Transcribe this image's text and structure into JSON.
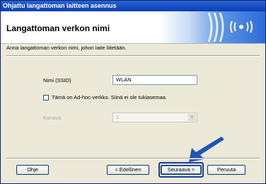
{
  "window": {
    "title": "Ohjattu langattoman laitteen asennus"
  },
  "header": {
    "title": "Langattoman verkon nimi"
  },
  "main": {
    "intro": "Anna langattoman verkon nimi, johon laite liitetään.",
    "ssid": {
      "label": "Nimi (SSID)",
      "value": "WLAN"
    },
    "adhoc": {
      "label": "Tämä on Ad-hoc-verkko. Siinä ei ole tukiasemaa.",
      "checked": false
    },
    "channel": {
      "label": "Kanava",
      "value": "1"
    }
  },
  "footer": {
    "help_label": "Ohje",
    "back_label": "< Edellinen",
    "next_label": "Seuraava >",
    "cancel_label": "Peruuta"
  },
  "colors": {
    "titlebar": "#0a3fb3",
    "banner": "#2d6bd8",
    "highlight": "#163e9e"
  }
}
